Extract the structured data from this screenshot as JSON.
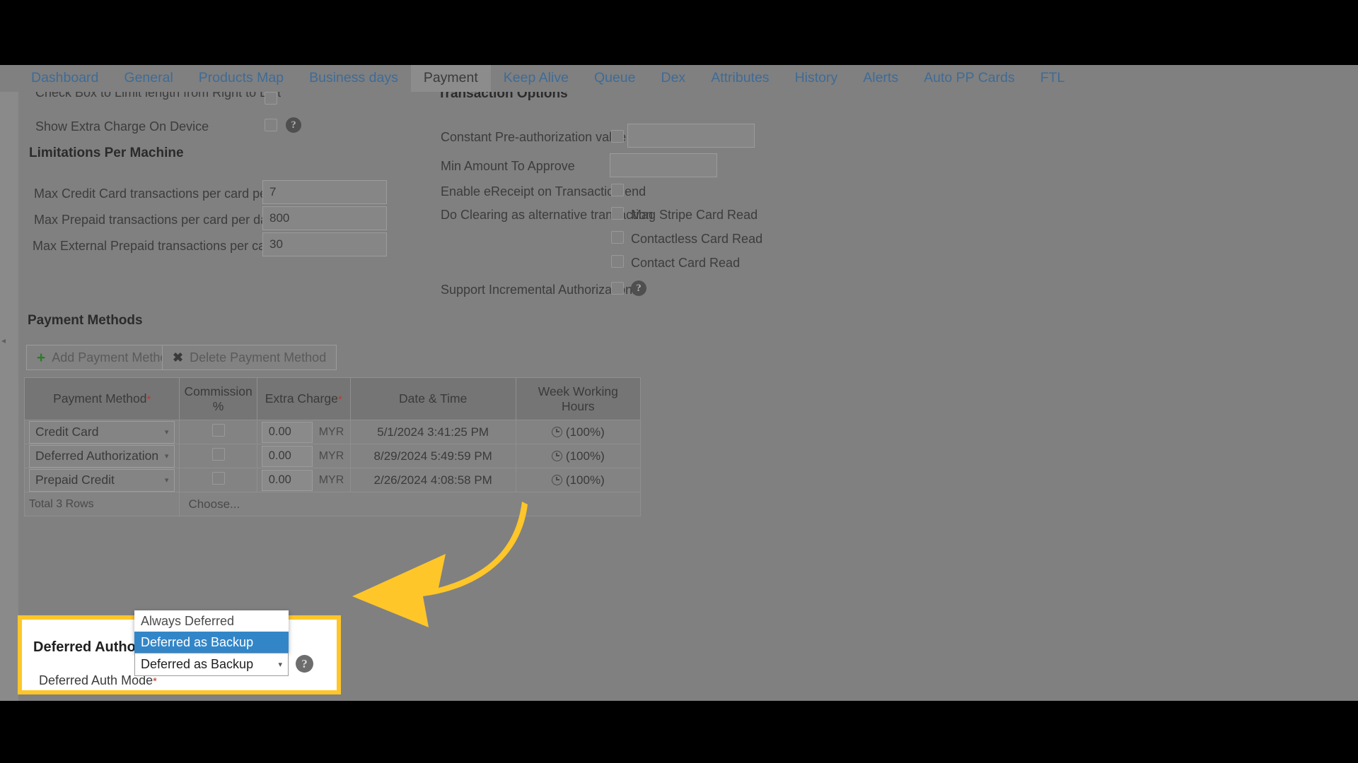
{
  "tabs": [
    {
      "label": "Dashboard",
      "active": false
    },
    {
      "label": "General",
      "active": false
    },
    {
      "label": "Products Map",
      "active": false
    },
    {
      "label": "Business days",
      "active": false
    },
    {
      "label": "Payment",
      "active": true
    },
    {
      "label": "Keep Alive",
      "active": false
    },
    {
      "label": "Queue",
      "active": false
    },
    {
      "label": "Dex",
      "active": false
    },
    {
      "label": "Attributes",
      "active": false
    },
    {
      "label": "History",
      "active": false
    },
    {
      "label": "Alerts",
      "active": false
    },
    {
      "label": "Auto PP Cards",
      "active": false
    },
    {
      "label": "FTL",
      "active": false
    }
  ],
  "left": {
    "clipped_row_label": "Check Box to Limit length from Right to Left",
    "show_extra_charge_label": "Show Extra Charge On Device",
    "limitations_title": "Limitations Per Machine",
    "limitations": [
      {
        "label": "Max Credit Card transactions per card per day",
        "value": "7"
      },
      {
        "label": "Max Prepaid transactions per card per day",
        "value": "800"
      },
      {
        "label": "Max External Prepaid transactions per card per day",
        "value": "30"
      }
    ]
  },
  "right": {
    "title": "Transaction Options",
    "constant_preauth_label": "Constant Pre-authorization value",
    "constant_preauth_value": "",
    "min_amount_label": "Min Amount To Approve",
    "min_amount_value": "",
    "ereceipt_label": "Enable eReceipt on Transaction end",
    "do_clearing_label": "Do Clearing as alternative transaction",
    "card_reads": [
      "Mag Stripe Card Read",
      "Contactless Card Read",
      "Contact Card Read"
    ],
    "incremental_auth_label": "Support Incremental Authorization"
  },
  "payment_methods": {
    "title": "Payment Methods",
    "add_button": "Add Payment Method",
    "delete_button": "Delete Payment Method",
    "columns": [
      {
        "label": "Payment Method",
        "required": true
      },
      {
        "label": "Commission %",
        "required": false
      },
      {
        "label": "Extra Charge",
        "required": true
      },
      {
        "label": "Date & Time",
        "required": false
      },
      {
        "label": "Week Working Hours",
        "required": false
      }
    ],
    "rows": [
      {
        "method": "Credit Card",
        "commission_checked": false,
        "extra_charge": "0.00",
        "currency": "MYR",
        "datetime": "5/1/2024 3:41:25 PM",
        "working_hours": "(100%)"
      },
      {
        "method": "Deferred Authorization",
        "commission_checked": false,
        "extra_charge": "0.00",
        "currency": "MYR",
        "datetime": "8/29/2024 5:49:59 PM",
        "working_hours": "(100%)"
      },
      {
        "method": "Prepaid Credit",
        "commission_checked": false,
        "extra_charge": "0.00",
        "currency": "MYR",
        "datetime": "2/26/2024 4:08:58 PM",
        "working_hours": "(100%)"
      }
    ],
    "total_rows": "Total 3 Rows",
    "choose_placeholder": "Choose..."
  },
  "deferred": {
    "section_title": "Deferred Authorization",
    "mode_label": "Deferred Auth Mode",
    "mode_required": "*",
    "selected_value": "Deferred as Backup",
    "options": [
      {
        "label": "Always Deferred",
        "selected": false
      },
      {
        "label": "Deferred as Backup",
        "selected": true
      }
    ]
  },
  "colors": {
    "highlight": "#ffc629",
    "selected_option": "#3286c8",
    "tab_link": "#3f6b96",
    "required": "#c0392b"
  }
}
